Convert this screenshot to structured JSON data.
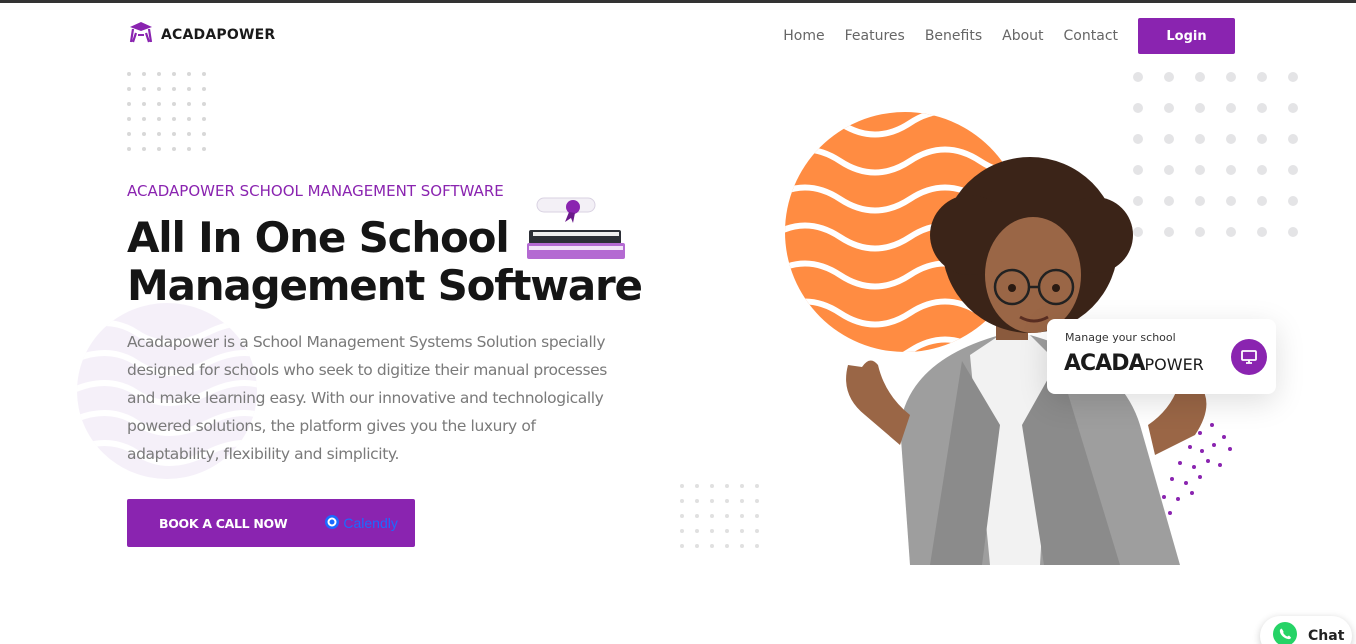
{
  "brand": {
    "name": "ACADAPOWER"
  },
  "nav": {
    "items": [
      {
        "label": "Home"
      },
      {
        "label": "Features"
      },
      {
        "label": "Benefits"
      },
      {
        "label": "About"
      },
      {
        "label": "Contact"
      }
    ],
    "login_label": "Login"
  },
  "hero": {
    "eyebrow": "ACADAPOWER SCHOOL MANAGEMENT SOFTWARE",
    "headline_line1": "All In One School",
    "headline_line2": "Management Software",
    "description": "Acadapower is a School Management Systems Solution specially designed for schools who seek to digitize their manual processes and make learning easy. With our innovative and technologically powered solutions, the platform gives you the luxury of adaptability, flexibility and simplicity.",
    "cta_label": "BOOK A CALL NOW",
    "cta_partner": "Calendly"
  },
  "card": {
    "subtitle": "Manage your school",
    "brand_bold": "ACADA",
    "brand_light": "POWER"
  },
  "chat": {
    "label": "Chat"
  },
  "colors": {
    "accent": "#8a24b0",
    "orange": "#ff8c42"
  },
  "icons": [
    "graduation-cap-icon",
    "books-icon",
    "monitor-icon",
    "whatsapp-icon",
    "calendly-icon"
  ]
}
